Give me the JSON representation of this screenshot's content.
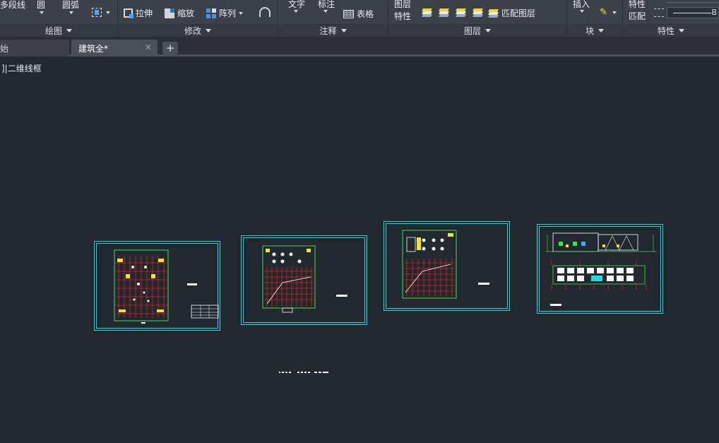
{
  "ribbon": {
    "draw": {
      "polyline": "多段线",
      "circle": "圆",
      "arc": "圆弧",
      "panel_title": "绘图"
    },
    "modify": {
      "stretch": "拉伸",
      "scale": "缩放",
      "array": "阵列",
      "panel_title": "修改"
    },
    "annotation": {
      "text": "文字",
      "dimension": "标注",
      "table": "表格",
      "panel_title": "注释"
    },
    "layers": {
      "layer_props_line1": "图层",
      "layer_props_line2": "特性",
      "match_layer": "匹配图层",
      "panel_title": "图层"
    },
    "block": {
      "insert": "插入",
      "panel_title": "块"
    },
    "properties": {
      "match_line1": "特性",
      "match_line2": "匹配",
      "panel_title": "特性",
      "linetype_suffix": "B"
    }
  },
  "tabs": [
    {
      "label": "始",
      "active": false
    },
    {
      "label": "建筑全*",
      "active": true
    }
  ],
  "viewport": {
    "label": "]|二维线框"
  },
  "colors": {
    "sheet_border": "#23d8e0",
    "grid_red": "#e0201c",
    "accent_green": "#3fe04a",
    "accent_yellow": "#f0e030",
    "background": "#212830"
  }
}
